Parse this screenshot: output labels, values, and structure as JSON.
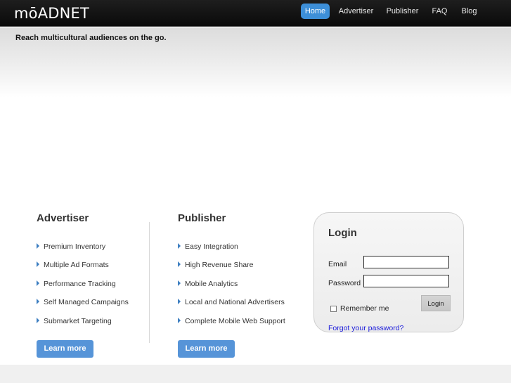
{
  "brand": "mōADNET",
  "nav": {
    "items": [
      {
        "label": "Home",
        "active": true
      },
      {
        "label": "Advertiser",
        "active": false
      },
      {
        "label": "Publisher",
        "active": false
      },
      {
        "label": "FAQ",
        "active": false
      },
      {
        "label": "Blog",
        "active": false
      }
    ]
  },
  "hero": {
    "tagline": "Reach multicultural audiences on the go."
  },
  "advertiser": {
    "heading": "Advertiser",
    "features": [
      "Premium Inventory",
      "Multiple Ad Formats",
      "Performance Tracking",
      "Self Managed Campaigns",
      "Submarket Targeting"
    ],
    "button": "Learn more"
  },
  "publisher": {
    "heading": "Publisher",
    "features": [
      "Easy Integration",
      "High Revenue Share",
      "Mobile Analytics",
      "Local and National Advertisers",
      "Complete Mobile Web Support"
    ],
    "button": "Learn more"
  },
  "login": {
    "title": "Login",
    "email_label": "Email",
    "email_value": "",
    "password_label": "Password",
    "password_value": "",
    "remember_label": "Remember me",
    "remember_checked": false,
    "button": "Login",
    "forgot": "Forgot your password?"
  },
  "colors": {
    "nav_active": "#3d8fd8",
    "learn_button": "#5694d8",
    "bullet": "#3d7fc1",
    "link": "#1a1adb"
  }
}
